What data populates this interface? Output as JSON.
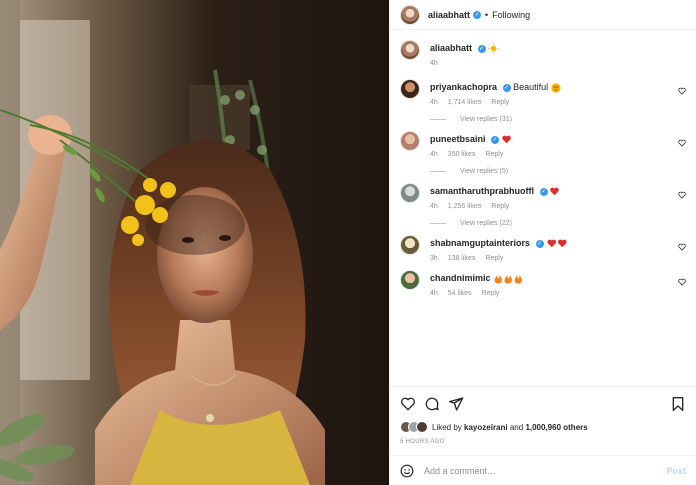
{
  "header": {
    "username": "aliaabhatt",
    "separator": "•",
    "follow_status": "Following"
  },
  "caption": {
    "username": "aliaabhatt",
    "emoji": "sun-emoji",
    "time": "4h"
  },
  "comments": [
    {
      "username": "priyankachopra",
      "verified": true,
      "text": "Beautiful",
      "emoji": "heart-eyes-emoji",
      "time": "4h",
      "likes": "1,714 likes",
      "reply": "Reply",
      "replies": "View replies (31)"
    },
    {
      "username": "puneetbsaini",
      "verified": true,
      "text": "",
      "emoji": "red-heart-emoji",
      "time": "4h",
      "likes": "350 likes",
      "reply": "Reply",
      "replies": "View replies (5)"
    },
    {
      "username": "samantharuthprabhuoffl",
      "verified": true,
      "text": "",
      "emoji": "red-heart-emoji",
      "time": "4h",
      "likes": "1,256 likes",
      "reply": "Reply",
      "replies": "View replies (22)"
    },
    {
      "username": "shabnamguptainteriors",
      "verified": true,
      "text": "",
      "emoji": "two-hearts-emoji",
      "time": "3h",
      "likes": "138 likes",
      "reply": "Reply",
      "replies": ""
    },
    {
      "username": "chandnimimic",
      "verified": false,
      "text": "",
      "emoji": "fire-emoji",
      "time": "4h",
      "likes": "54 likes",
      "reply": "Reply",
      "replies": ""
    }
  ],
  "likes": {
    "prefix": "Liked by",
    "user": "kayozeirani",
    "mid": "and",
    "count": "1,000,960 others"
  },
  "posted_ago": "5 HOURS AGO",
  "add_comment": {
    "placeholder": "Add a comment…",
    "post_label": "Post"
  },
  "colors": {
    "verified": "#3897f0",
    "heart": "#ed4956",
    "post_disabled": "#b2dffc",
    "muted": "#8e8e8e"
  }
}
